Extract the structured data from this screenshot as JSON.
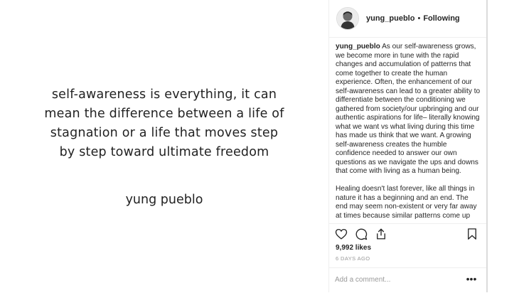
{
  "post": {
    "quote_lines": [
      "self-awareness is everything, it can",
      "mean the difference between a life of",
      "stagnation or a life that moves step",
      "by step toward ultimate freedom"
    ],
    "author": "yung pueblo"
  },
  "header": {
    "username": "yung_pueblo",
    "separator": "•",
    "follow_status": "Following"
  },
  "caption": {
    "username": "yung_pueblo",
    "paragraph1": "As our self-awareness grows, we become more in tune with the rapid changes and accumulation of patterns that come together to create the human experience. Often, the enhancement of our self-awareness can lead to a greater ability to differentiate between the conditioning we gathered from society/our upbringing and our authentic aspirations for life– literally knowing what we want vs what living during this time has made us think that we want. A growing self-awareness creates the humble confidence needed to answer our own questions as we navigate the ups and downs that come with living as a human being.",
    "paragraph2": "Healing doesn't last forever, like all things in nature it has a beginning and an end. The end may seem non-existent or very far away at times because similar patterns come up"
  },
  "actions": {
    "like_icon": "heart-outline-icon",
    "comment_icon": "speech-bubble-icon",
    "share_icon": "share-upload-icon",
    "save_icon": "bookmark-icon"
  },
  "likes": "9,992 likes",
  "timestamp": "6 DAYS AGO",
  "comment": {
    "placeholder": "Add a comment...",
    "more_label": "•••"
  }
}
